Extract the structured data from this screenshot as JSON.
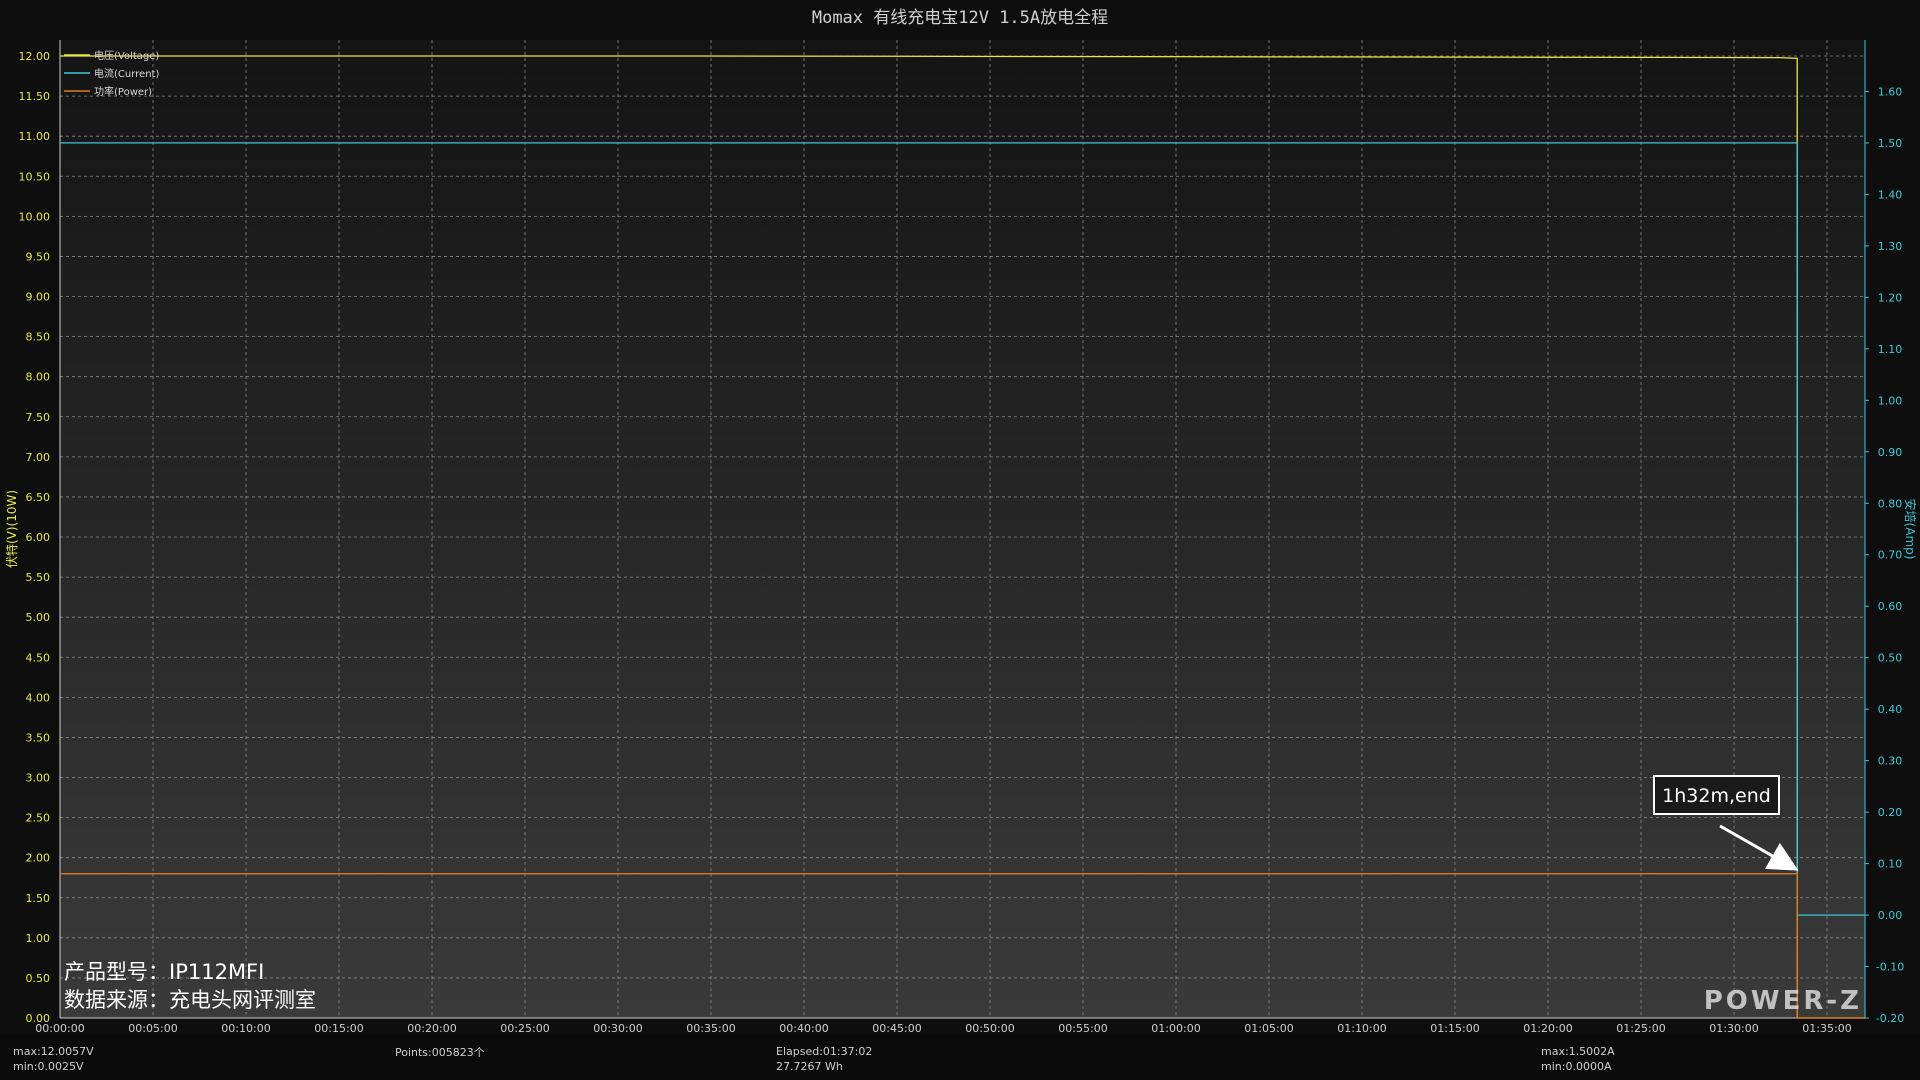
{
  "chart_data": {
    "type": "line",
    "title": "Momax 有线充电宝12V 1.5A放电全程",
    "ylabel_left": "伏特(V)(10W)",
    "ylabel_right": "安培(Amp)",
    "x_ticks": [
      "00:00:00",
      "00:05:00",
      "00:10:00",
      "00:15:00",
      "00:20:00",
      "00:25:00",
      "00:30:00",
      "00:35:00",
      "00:40:00",
      "00:45:00",
      "00:50:00",
      "00:55:00",
      "01:00:00",
      "01:05:00",
      "01:10:00",
      "01:15:00",
      "01:20:00",
      "01:25:00",
      "01:30:00",
      "01:35:00"
    ],
    "xlim_minutes": [
      0,
      97
    ],
    "ylim_left": [
      0,
      12.2
    ],
    "ylim_right": [
      -0.2,
      1.7
    ],
    "y_ticks_left": [
      "0.00",
      "0.50",
      "1.00",
      "1.50",
      "2.00",
      "2.50",
      "3.00",
      "3.50",
      "4.00",
      "4.50",
      "5.00",
      "5.50",
      "6.00",
      "6.50",
      "7.00",
      "7.50",
      "8.00",
      "8.50",
      "9.00",
      "9.50",
      "10.00",
      "10.50",
      "11.00",
      "11.50",
      "12.00"
    ],
    "y_ticks_right": [
      "-0.20",
      "-0.10",
      "0.00",
      "0.10",
      "0.20",
      "0.30",
      "0.40",
      "0.50",
      "0.60",
      "0.70",
      "0.80",
      "0.90",
      "1.00",
      "1.10",
      "1.20",
      "1.30",
      "1.40",
      "1.50",
      "1.60"
    ],
    "grid": true,
    "legend_position": "top-left",
    "series": [
      {
        "name": "电压(Voltage)",
        "axis": "left",
        "color": "#e8e84a",
        "x": [
          0,
          34,
          34.5,
          92.5,
          93.4,
          93.4,
          97
        ],
        "y": [
          12.0,
          12.0,
          12.0,
          11.98,
          11.97,
          0.0,
          0.0
        ]
      },
      {
        "name": "电流(Current)",
        "axis": "right",
        "color": "#3fc6d6",
        "x": [
          0,
          93.4,
          93.4,
          97
        ],
        "y": [
          1.5,
          1.5,
          0.0,
          0.0
        ]
      },
      {
        "name": "功率(Power)",
        "axis": "left",
        "color": "#e07a1f",
        "x": [
          0,
          93.4,
          93.4,
          97
        ],
        "y": [
          1.8,
          1.8,
          0.0,
          0.0
        ]
      }
    ],
    "annotation": {
      "text": "1h32m,end",
      "x": 93.4,
      "y_left": 1.8
    }
  },
  "stats": {
    "vmax": "max:12.0057V",
    "vmin": "min:0.0025V",
    "points": "Points:005823个",
    "elapsed": "Elapsed:01:37:02",
    "energy": "27.7267 Wh",
    "amax": "max:1.5002A",
    "amin": "min:0.0000A"
  },
  "watermark": {
    "model": "产品型号：IP112MFI",
    "source": "数据来源：充电头网评测室"
  },
  "brand": "POWER-Z",
  "colors": {
    "background": "#0e0e0e",
    "plot_top": "#141414",
    "plot_bottom": "#3a3a3a",
    "grid": "#8a8a8a",
    "axis_left": "#e8e84a",
    "axis_right": "#3fc6d6"
  }
}
